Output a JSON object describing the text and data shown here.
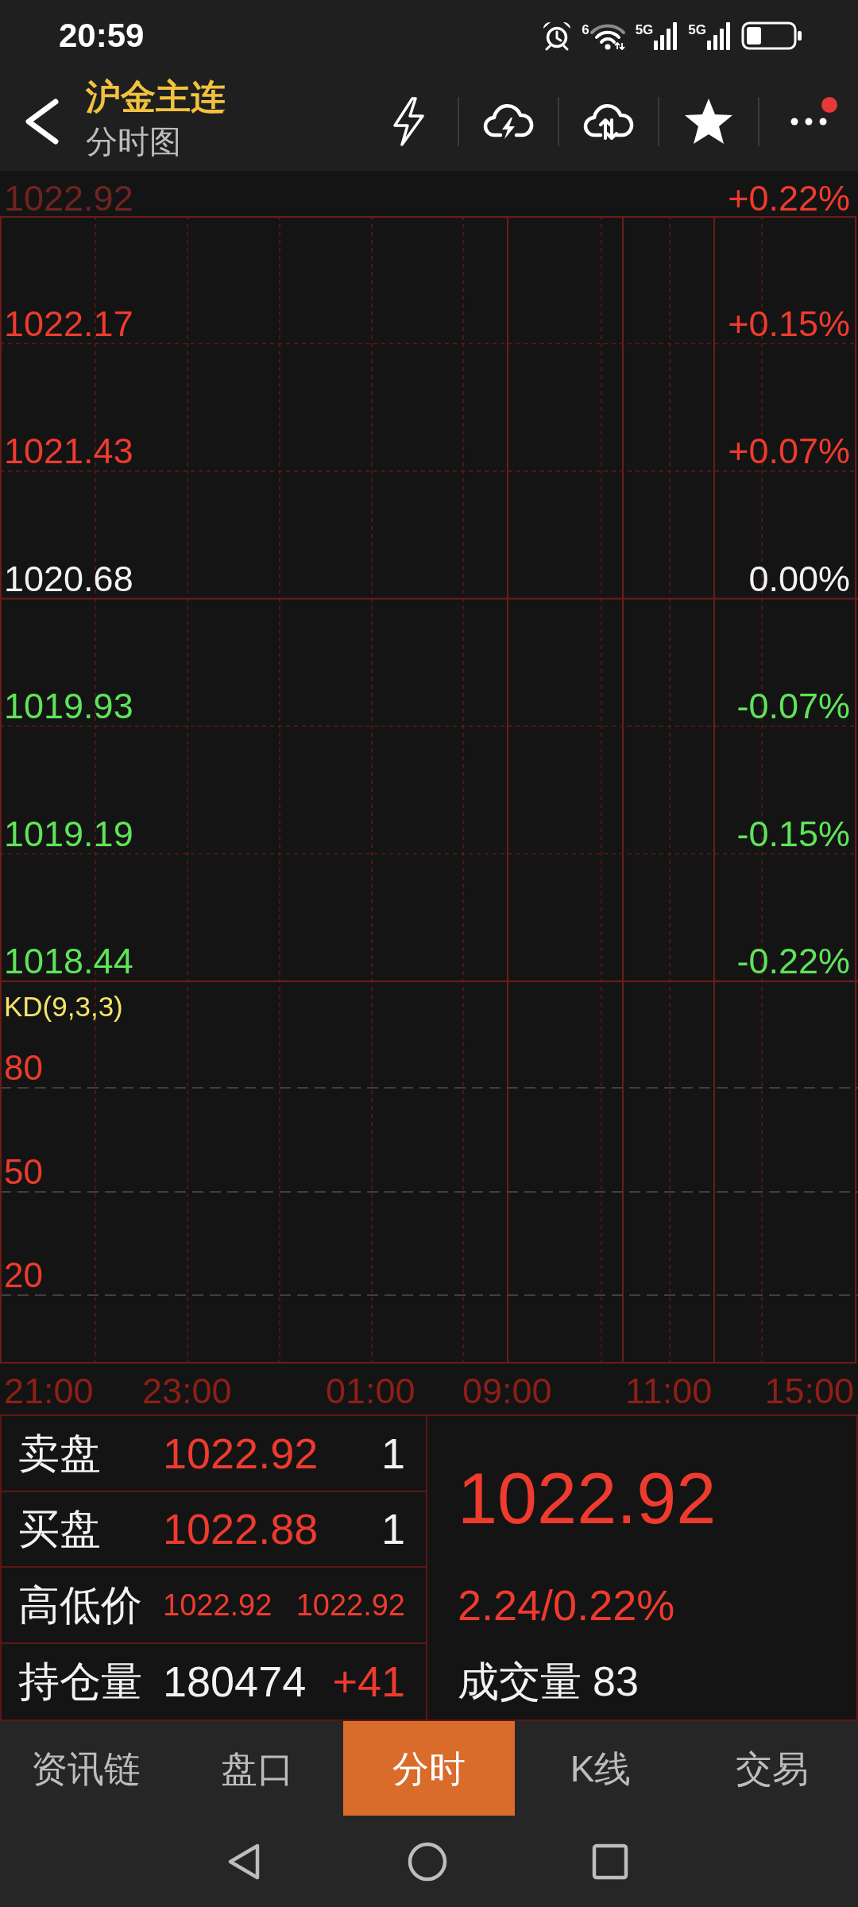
{
  "status_bar": {
    "time": "20:59",
    "wifi_label": "6",
    "sim_labels": [
      "5G",
      "5G"
    ]
  },
  "header": {
    "title": "沪金主连",
    "subtitle": "分时图",
    "notification_dot": true
  },
  "price_axis": [
    {
      "price": "1022.92",
      "change": "+0.22%",
      "color": "#ee3b2e",
      "price_dimmed": true
    },
    {
      "price": "1022.17",
      "change": "+0.15%",
      "color": "#ee3b2e",
      "price_dimmed": false
    },
    {
      "price": "1021.43",
      "change": "+0.07%",
      "color": "#ee3b2e",
      "price_dimmed": false
    },
    {
      "price": "1020.68",
      "change": "0.00%",
      "color": "#f2f2f2",
      "price_dimmed": false
    },
    {
      "price": "1019.93",
      "change": "-0.07%",
      "color": "#5fe35a",
      "price_dimmed": false
    },
    {
      "price": "1019.19",
      "change": "-0.15%",
      "color": "#5fe35a",
      "price_dimmed": false
    },
    {
      "price": "1018.44",
      "change": "-0.22%",
      "color": "#5fe35a",
      "price_dimmed": false
    }
  ],
  "indicator": {
    "title": "KD(9,3,3)",
    "levels": [
      "80",
      "50",
      "20"
    ]
  },
  "time_axis": [
    "21:00",
    "23:00",
    "01:00",
    "09:00",
    "11:00",
    "15:00"
  ],
  "quote": {
    "rows": [
      {
        "label": "卖盘",
        "kind": "order",
        "values": [
          {
            "text": "1022.92",
            "color": "#ee3b2e"
          },
          {
            "text": "1",
            "color": "#f2f2f2"
          }
        ]
      },
      {
        "label": "买盘",
        "kind": "order",
        "values": [
          {
            "text": "1022.88",
            "color": "#ee3b2e"
          },
          {
            "text": "1",
            "color": "#f2f2f2"
          }
        ]
      },
      {
        "label": "高低价",
        "kind": "range",
        "values": [
          {
            "text": "1022.92",
            "color": "#ee3b2e"
          },
          {
            "text": "1022.92",
            "color": "#ee3b2e"
          }
        ]
      },
      {
        "label": "持仓量",
        "kind": "position",
        "values": [
          {
            "text": "180474",
            "color": "#f2f2f2"
          },
          {
            "text": "+41",
            "color": "#ee3b2e"
          }
        ]
      }
    ],
    "color": "#ee3b2e",
    "last_price": "1022.92",
    "change": "2.24/0.22%",
    "volume_label": "成交量",
    "volume": "83"
  },
  "tabs": [
    {
      "label": "资讯链",
      "selected": false
    },
    {
      "label": "盘口",
      "selected": false
    },
    {
      "label": "分时",
      "selected": true
    },
    {
      "label": "K线",
      "selected": false
    },
    {
      "label": "交易",
      "selected": false
    }
  ]
}
